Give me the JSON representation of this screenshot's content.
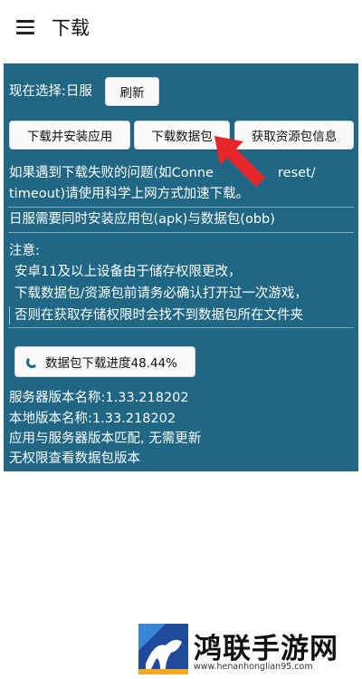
{
  "app": {
    "title": "下载",
    "menu_icon": "hamburger-icon"
  },
  "panel": {
    "selection_label": "现在选择:日服",
    "refresh_label": "刷新",
    "buttons": {
      "download_install": "下载并安装应用",
      "download_data": "下载数据包",
      "get_info": "获取资源包信息"
    },
    "notice_line1_a": "如果遇到下载失败的问题(如Conne",
    "notice_line1_b": "reset/",
    "notice_line2": "timeout)请使用科学上网方式加速下载。",
    "jp_note": "日服需要同时安装应用包(apk)与数据包(obb)",
    "attention_title": "注意:",
    "attention_lines": [
      "安卓11及以上设备由于储存权限更改，",
      "下载数据包/资源包前请务必确认打开过一次游戏，",
      "否则在获取存储权限时会找不到数据包所在文件夹"
    ],
    "progress_label": "数据包下载进度48.44%",
    "progress_percent": 48.44,
    "version_info": [
      "服务器版本名称:1.33.218202",
      "本地版本名称:1.33.218202",
      "应用与服务器版本匹配, 无需更新",
      "无权限查看数据包版本"
    ]
  },
  "colors": {
    "panel_bg": "#1f6785",
    "arrow": "#e8262a"
  },
  "watermark": {
    "name": "鸿联手游网",
    "url": "www.henanhonglian95.com"
  }
}
